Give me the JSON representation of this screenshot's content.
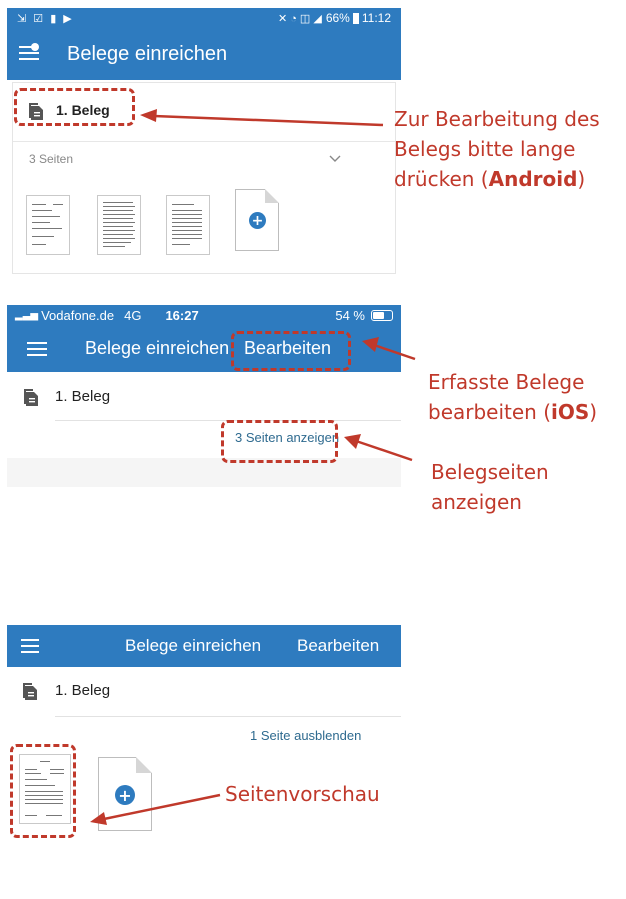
{
  "android": {
    "status_icons_left": "⇲ ☑ ▮ ▶",
    "status_right": "66%",
    "status_time": "11:12",
    "title": "Belege einreichen",
    "beleg_label": "1. Beleg",
    "pages_label": "3 Seiten"
  },
  "ios": {
    "carrier": "Vodafone.de",
    "network": "4G",
    "time": "16:27",
    "battery": "54 %",
    "title": "Belege einreichen",
    "edit": "Bearbeiten",
    "beleg_label": "1. Beleg",
    "show_pages": "3 Seiten anzeigen"
  },
  "ios2": {
    "title": "Belege einreichen",
    "edit": "Bearbeiten",
    "beleg_label": "1. Beleg",
    "hide_pages": "1 Seite ausblenden"
  },
  "annotations": {
    "a1_line1": "Zur Bearbeitung des",
    "a1_line2": "Belegs bitte lange",
    "a1_line3_pre": "drücken (",
    "a1_line3_bold": "Android",
    "a1_line3_post": ")",
    "a2_line1": "Erfasste Belege",
    "a2_line2_pre": "bearbeiten (",
    "a2_line2_bold": "iOS",
    "a2_line2_post": ")",
    "a3_line1": "Belegseiten",
    "a3_line2": "anzeigen",
    "a4": "Seitenvorschau"
  },
  "colors": {
    "primary": "#2e7bbf",
    "annotation": "#c0392b"
  },
  "icons": [
    "menu-icon",
    "document-icon",
    "chevron-down-icon",
    "add-page-icon",
    "wifi-icon",
    "battery-icon"
  ]
}
